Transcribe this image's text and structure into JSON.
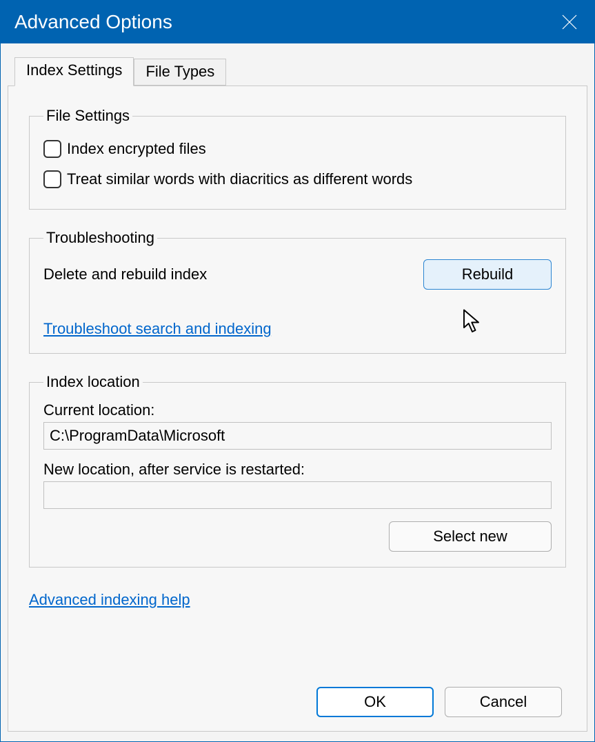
{
  "title": "Advanced Options",
  "tabs": {
    "index_settings": "Index Settings",
    "file_types": "File Types"
  },
  "file_settings": {
    "legend": "File Settings",
    "encrypted": "Index encrypted files",
    "diacritics": "Treat similar words with diacritics as different words"
  },
  "troubleshooting": {
    "legend": "Troubleshooting",
    "delete_rebuild": "Delete and rebuild index",
    "rebuild_btn": "Rebuild",
    "link": "Troubleshoot search and indexing"
  },
  "location": {
    "legend": "Index location",
    "current_label": "Current location:",
    "current_value": "C:\\ProgramData\\Microsoft",
    "new_label": "New location, after service is restarted:",
    "new_value": "",
    "select_new_btn": "Select new"
  },
  "help_link": "Advanced indexing help",
  "buttons": {
    "ok": "OK",
    "cancel": "Cancel"
  }
}
